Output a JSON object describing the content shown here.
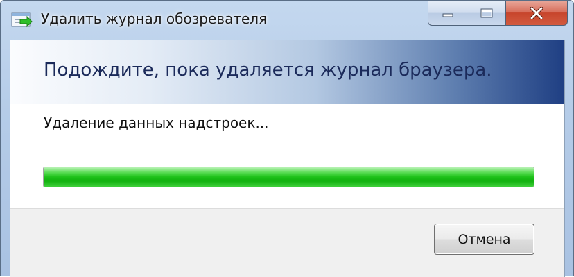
{
  "window": {
    "title": "Удалить журнал обозревателя",
    "icon": "browser-history-delete-icon"
  },
  "caption_buttons": {
    "minimize_icon": "minimize-icon",
    "maximize_icon": "maximize-icon",
    "close_icon": "close-icon"
  },
  "dialog": {
    "header": "Подождите, пока удаляется журнал браузера.",
    "status": "Удаление данных надстроек...",
    "progress_fraction": 1.0,
    "cancel_label": "Отмена"
  },
  "colors": {
    "progress_green": "#1ec11a",
    "header_gradient_end": "#1f3f83",
    "close_button": "#c7452c"
  }
}
